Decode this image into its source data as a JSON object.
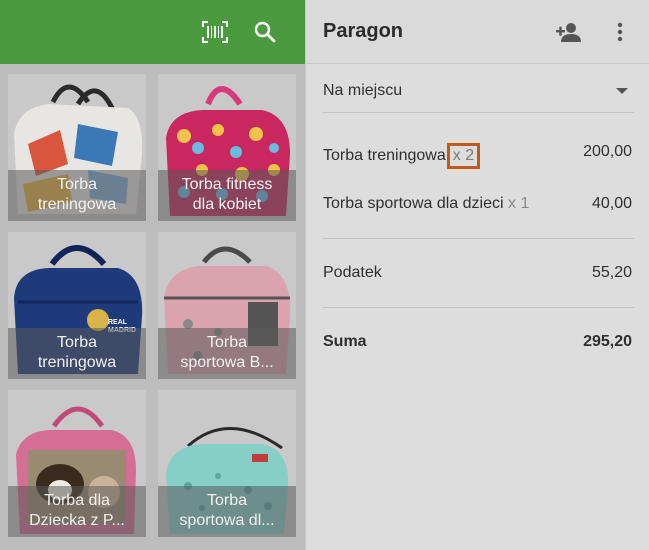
{
  "left": {
    "icons": [
      "barcode-icon",
      "search-icon"
    ],
    "products": [
      {
        "line1": "Torba",
        "line2": "treningowa",
        "palette": "white"
      },
      {
        "line1": "Torba fitness",
        "line2": "dla kobiet",
        "palette": "dots"
      },
      {
        "line1": "Torba",
        "line2": "treningowa",
        "palette": "navy"
      },
      {
        "line1": "Torba",
        "line2": "sportowa B...",
        "palette": "pink"
      },
      {
        "line1": "Torba dla",
        "line2": "Dziecka z P...",
        "palette": "dog"
      },
      {
        "line1": "Torba",
        "line2": "sportowa dl...",
        "palette": "mint"
      }
    ]
  },
  "receipt": {
    "title": "Paragon",
    "icons": [
      "add-person-icon",
      "more-vert-icon"
    ],
    "order_type": "Na miejscu",
    "items": [
      {
        "name": "Torba treningowa",
        "qty": "x 2",
        "amount": "200,00"
      },
      {
        "name": "Torba sportowa dla dzieci",
        "qty": "x 1",
        "amount": "40,00"
      }
    ],
    "tax_label": "Podatek",
    "tax_amount": "55,20",
    "total_label": "Suma",
    "total_amount": "295,20"
  },
  "colors": {
    "toolbar_green": "#4b9a40",
    "highlight_box": "#c05a19"
  }
}
